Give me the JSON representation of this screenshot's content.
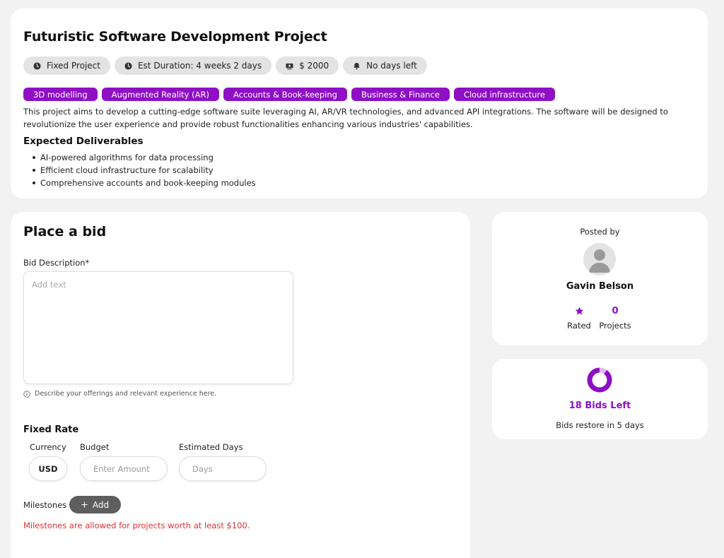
{
  "project": {
    "title": "Futuristic Software Development Project",
    "meta": [
      {
        "icon": "clock-icon",
        "label": "Fixed Project"
      },
      {
        "icon": "clock-icon",
        "label": "Est Duration: 4 weeks 2 days"
      },
      {
        "icon": "money-icon",
        "label": "$ 2000"
      },
      {
        "icon": "bell-icon",
        "label": "No days left"
      }
    ],
    "tags": [
      "3D modelling",
      "Augmented Reality (AR)",
      "Accounts & Book-keeping",
      "Business & Finance",
      "Cloud infrastructure"
    ],
    "description": "This project aims to develop a cutting-edge software suite leveraging AI, AR/VR technologies, and advanced API integrations. The software will be designed to revolutionize the user experience and provide robust functionalities enhancing various industries' capabilities.",
    "deliverables_title": "Expected Deliverables",
    "deliverables": [
      "AI-powered algorithms for data processing",
      "Efficient cloud infrastructure for scalability",
      "Comprehensive accounts and book-keeping modules"
    ]
  },
  "bid": {
    "title": "Place a bid",
    "description_label": "Bid Description*",
    "description_placeholder": "Add text",
    "hint": "Describe your offerings and relevant experience here.",
    "fixed_rate_title": "Fixed Rate",
    "currency_label": "Currency",
    "currency_value": "USD",
    "budget_label": "Budget",
    "budget_placeholder": "Enter Amount",
    "days_label": "Estimated Days",
    "days_placeholder": "Days",
    "milestones_label": "Milestones",
    "add_label": "Add",
    "warning": "Milestones are allowed for projects worth at least $100."
  },
  "poster": {
    "posted_by": "Posted by",
    "name": "Gavin Belson",
    "rated_label": "Rated",
    "projects_value": "0",
    "projects_label": "Projects"
  },
  "bids": {
    "left_label": "18 Bids Left",
    "restore_label": "Bids restore in 5 days",
    "remaining_fraction": 0.9
  },
  "colors": {
    "accent": "#8e0fc4",
    "accent_light": "#e6b8f2",
    "warning": "#e03131",
    "chip_bg": "#e3e3e3"
  }
}
